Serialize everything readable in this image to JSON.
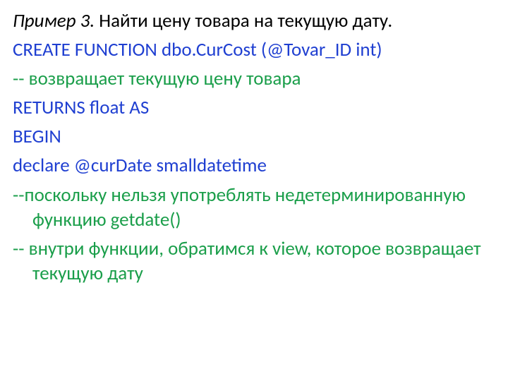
{
  "lines": {
    "l1_prefix": "Пример 3. ",
    "l1_rest": "Найти цену товара на текущую дату.",
    "l2": "CREATE FUNCTION dbo.CurCost (@Tovar_ID int)",
    "l3": "-- возвращает текущую цену товара",
    "l4": "RETURNS float AS",
    "l5": "BEGIN",
    "l6": "declare @curDate smalldatetime",
    "l7": "--поскольку нельзя употреблять недетерминированную функцию getdate()",
    "l8": "-- внутри функции, обратитмся к view, которое возвращает текущую дату"
  },
  "lines_fix": {
    "l8": "-- внутри функции, обратимся к view, которое возвращает текущую дату"
  }
}
